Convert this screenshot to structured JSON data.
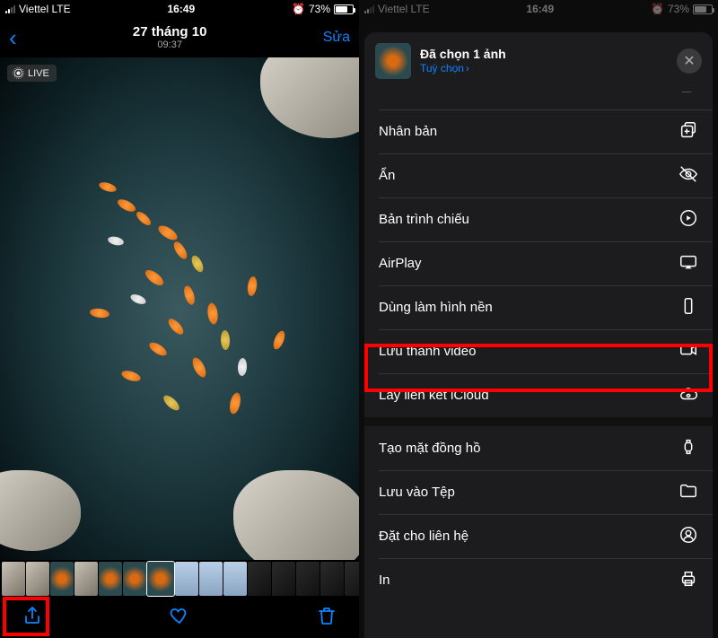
{
  "status": {
    "carrier": "Viettel LTE",
    "time": "16:49",
    "battery_percent": "73%",
    "alarm": true
  },
  "left": {
    "nav_title": "27 tháng 10",
    "nav_subtitle": "09:37",
    "edit_label": "Sửa",
    "live_badge": "LIVE"
  },
  "sheet": {
    "title": "Đã chọn 1 ảnh",
    "options_label": "Tuỳ chọn",
    "actions": {
      "duplicate": "Nhân bản",
      "hide": "Ẩn",
      "slideshow": "Bản trình chiếu",
      "airplay": "AirPlay",
      "wallpaper": "Dùng làm hình nền",
      "save_video": "Lưu thành video",
      "icloud_link": "Lấy liên kết iCloud",
      "watch_face": "Tạo mặt đồng hồ",
      "save_files": "Lưu vào Tệp",
      "assign_contact": "Đặt cho liên hệ",
      "print": "In"
    }
  },
  "icons": {
    "back": "back-chevron",
    "share": "share-icon",
    "heart": "heart-icon",
    "trash": "trash-icon"
  }
}
